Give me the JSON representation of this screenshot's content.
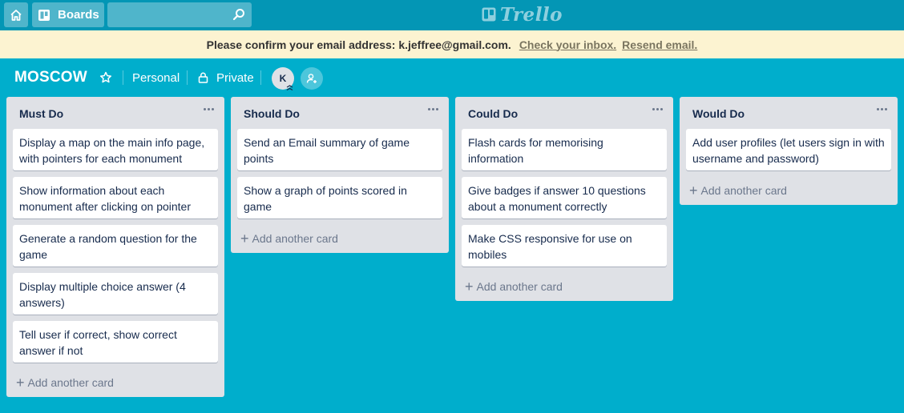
{
  "header": {
    "boards_label": "Boards",
    "search_placeholder": "",
    "logo_text": "Trello"
  },
  "banner": {
    "message": "Please confirm your email address: k.jeffree@gmail.com.",
    "link_check": "Check your inbox.",
    "link_resend": "Resend email."
  },
  "board": {
    "title": "MOSCOW",
    "team": "Personal",
    "visibility": "Private",
    "member_initial": "K"
  },
  "lists": [
    {
      "title": "Must Do",
      "cards": [
        "Display a map on the main info page, with pointers for each monument",
        "Show information about each monument after clicking on pointer",
        "Generate a random question for the game",
        "Display multiple choice answer (4 answers)",
        "Tell user if correct, show correct answer if not"
      ],
      "add_label": "Add another card"
    },
    {
      "title": "Should Do",
      "cards": [
        "Send an Email summary of game points",
        "Show a graph of points scored in game"
      ],
      "add_label": "Add another card"
    },
    {
      "title": "Could Do",
      "cards": [
        "Flash cards for memorising information",
        "Give badges if answer 10 questions about a monument correctly",
        "Make CSS responsive for use on mobiles"
      ],
      "add_label": "Add another card"
    },
    {
      "title": "Would Do",
      "cards": [
        "Add user profiles (let users sign in with username and password)"
      ],
      "add_label": "Add another card"
    }
  ],
  "colors": {
    "board_background": "#00AECC",
    "header_background": "#0396B5",
    "banner_background": "#FCF3D1",
    "list_background": "#DFE1E6"
  }
}
